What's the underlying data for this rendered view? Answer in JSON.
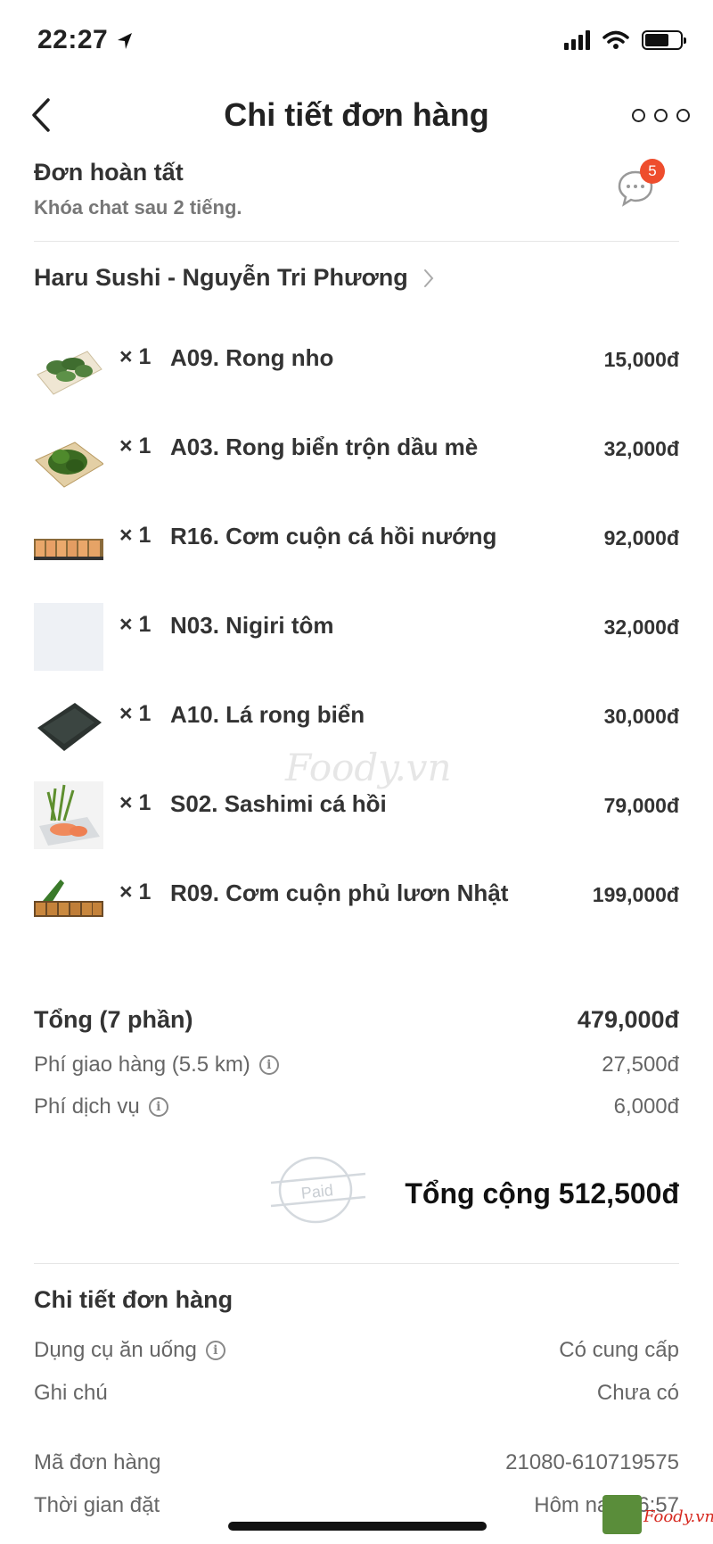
{
  "status_bar": {
    "time": "22:27"
  },
  "header": {
    "title": "Chi tiết đơn hàng"
  },
  "order_status": {
    "title": "Đơn hoàn tất",
    "subtitle": "Khóa chat sau 2 tiếng.",
    "unread_count": "5"
  },
  "restaurant": {
    "name": "Haru Sushi - Nguyễn Tri Phương"
  },
  "items": [
    {
      "qty": "× 1",
      "name": "A09. Rong nho",
      "price": "15,000đ"
    },
    {
      "qty": "× 1",
      "name": "A03. Rong biển trộn dầu mè",
      "price": "32,000đ"
    },
    {
      "qty": "× 1",
      "name": "R16. Cơm cuộn cá hồi nướng",
      "price": "92,000đ"
    },
    {
      "qty": "× 1",
      "name": "N03. Nigiri tôm",
      "price": "32,000đ"
    },
    {
      "qty": "× 1",
      "name": "A10. Lá rong biển",
      "price": "30,000đ"
    },
    {
      "qty": "× 1",
      "name": "S02. Sashimi cá hồi",
      "price": "79,000đ"
    },
    {
      "qty": "× 1",
      "name": "R09. Cơm cuộn phủ lươn Nhật",
      "price": "199,000đ"
    }
  ],
  "summary": {
    "subtotal_label": "Tổng (7 phần)",
    "subtotal_value": "479,000đ",
    "delivery_label": "Phí giao hàng (5.5 km)",
    "delivery_value": "27,500đ",
    "service_label": "Phí dịch vụ",
    "service_value": "6,000đ",
    "paid_stamp": "Paid",
    "grand_total": "Tổng cộng 512,500đ"
  },
  "details": {
    "title": "Chi tiết đơn hàng",
    "utensils_label": "Dụng cụ ăn uống",
    "utensils_value": "Có cung cấp",
    "note_label": "Ghi chú",
    "note_value": "Chưa có",
    "order_id_label": "Mã đơn hàng",
    "order_id_value": "21080-610719575",
    "order_time_label": "Thời gian đặt",
    "order_time_value": "Hôm nay 16:57"
  },
  "watermark": {
    "text": "Foody.vn"
  },
  "corner_logo": {
    "text": "Foody.vn"
  },
  "colors": {
    "accent": "#ee4d2d",
    "text": "#333333",
    "muted": "#777777"
  },
  "icons": [
    "back-chevron-icon",
    "more-dots-icon",
    "chat-bubble-icon",
    "chevron-right-icon",
    "info-icon",
    "paid-stamp-icon"
  ]
}
